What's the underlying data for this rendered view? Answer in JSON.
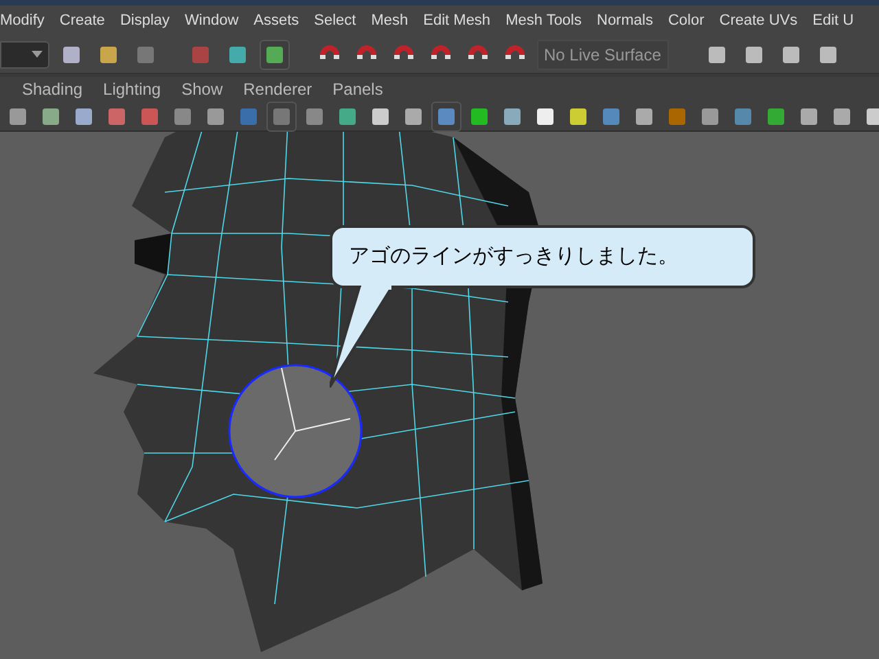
{
  "menu_bar": [
    "Modify",
    "Create",
    "Display",
    "Window",
    "Assets",
    "Select",
    "Mesh",
    "Edit Mesh",
    "Mesh Tools",
    "Normals",
    "Color",
    "Create UVs",
    "Edit U"
  ],
  "toolbar": {
    "live_surface": "No Live Surface"
  },
  "panel_menu": [
    "Shading",
    "Lighting",
    "Show",
    "Renderer",
    "Panels"
  ],
  "callout": {
    "text": "アゴのラインがすっきりしました。"
  }
}
